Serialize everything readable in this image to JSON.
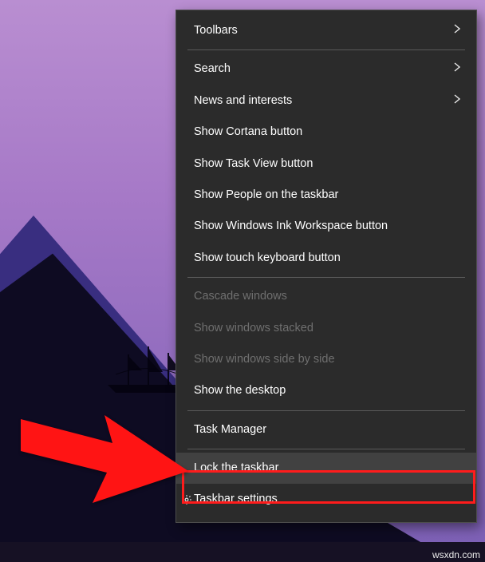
{
  "menu": {
    "toolbars": "Toolbars",
    "search": "Search",
    "news": "News and interests",
    "cortana": "Show Cortana button",
    "taskview": "Show Task View button",
    "people": "Show People on the taskbar",
    "ink": "Show Windows Ink Workspace button",
    "touchkb": "Show touch keyboard button",
    "cascade": "Cascade windows",
    "stacked": "Show windows stacked",
    "sidebyside": "Show windows side by side",
    "showdesktop": "Show the desktop",
    "taskmgr": "Task Manager",
    "lock": "Lock the taskbar",
    "settings": "Taskbar settings"
  },
  "watermark": "wsxdn.com"
}
